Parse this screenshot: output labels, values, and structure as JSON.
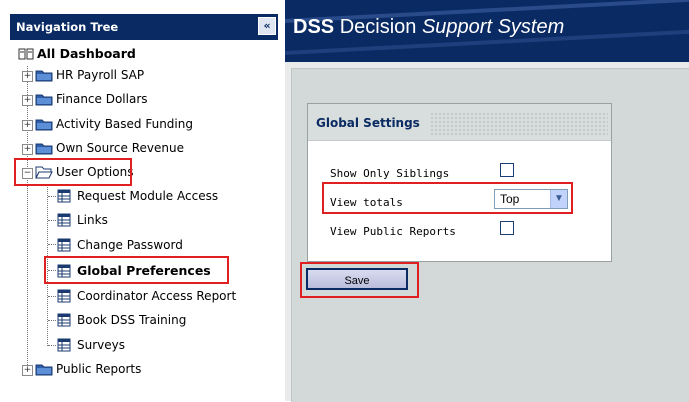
{
  "nav": {
    "title": "Navigation Tree",
    "collapse_glyph": "«",
    "root": "All Dashboard",
    "items": [
      {
        "label": "HR Payroll SAP",
        "icon": "folder-icon",
        "toggle": "+"
      },
      {
        "label": "Finance Dollars",
        "icon": "folder-icon",
        "toggle": "+"
      },
      {
        "label": "Activity Based Funding",
        "icon": "folder-icon",
        "toggle": "+"
      },
      {
        "label": "Own Source Revenue",
        "icon": "folder-icon",
        "toggle": "+"
      },
      {
        "label": "User Options",
        "icon": "folder-open-icon",
        "toggle": "−"
      },
      {
        "label": "Public Reports",
        "icon": "folder-icon",
        "toggle": "+"
      }
    ],
    "user_options_children": [
      {
        "label": "Request Module Access"
      },
      {
        "label": "Links"
      },
      {
        "label": "Change Password"
      },
      {
        "label": "Global Preferences",
        "selected": true
      },
      {
        "label": "Coordinator Access Report"
      },
      {
        "label": "Book DSS Training"
      },
      {
        "label": "Surveys"
      }
    ]
  },
  "banner": {
    "dss": "DSS",
    "decision": "Decision",
    "support": "Support",
    "system": "System"
  },
  "settings": {
    "title": "Global Settings",
    "show_only_siblings_label": "Show Only Siblings",
    "view_totals_label": "View totals",
    "view_totals_value": "Top",
    "view_public_reports_label": "View Public Reports"
  },
  "save_label": "Save",
  "colors": {
    "nav_header": "#0a2a63",
    "highlight": "#e02020",
    "content_bg": "#d3d9d8"
  }
}
